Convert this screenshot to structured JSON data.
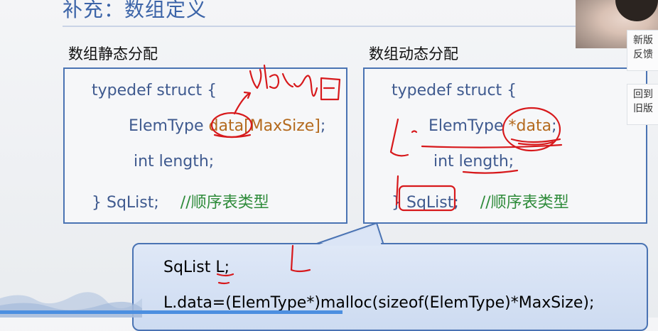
{
  "slide": {
    "title": "补充：数组定义"
  },
  "static": {
    "heading": "数组静态分配",
    "line1": "typedef struct {",
    "line2_type": "ElemType ",
    "line2_data": "data",
    "line2_size": "[MaxSize]",
    "line2_semicolon": ";",
    "line3": "int length;",
    "line4_name": "} SqList;",
    "line4_comment": "//顺序表类型"
  },
  "dynamic": {
    "heading": "数组动态分配",
    "line1": "typedef struct {",
    "line2_type": "ElemType ",
    "line2_data": "*data",
    "line2_semicolon": ";",
    "line3": "int length;",
    "line4_name": "} SqList;",
    "line4_comment": "//顺序表类型"
  },
  "callout": {
    "line1": "SqList L;",
    "line2": "L.data=(ElemType*)malloc(sizeof(ElemType)*MaxSize);"
  },
  "side_panel": {
    "new_version": "新版\n反馈",
    "old_version": "回到\n旧版"
  },
  "annotations": {
    "handwriting": "data[]",
    "letter": "L",
    "ink_color": "#d7191c"
  },
  "playback": {
    "progress_percent": 52
  }
}
